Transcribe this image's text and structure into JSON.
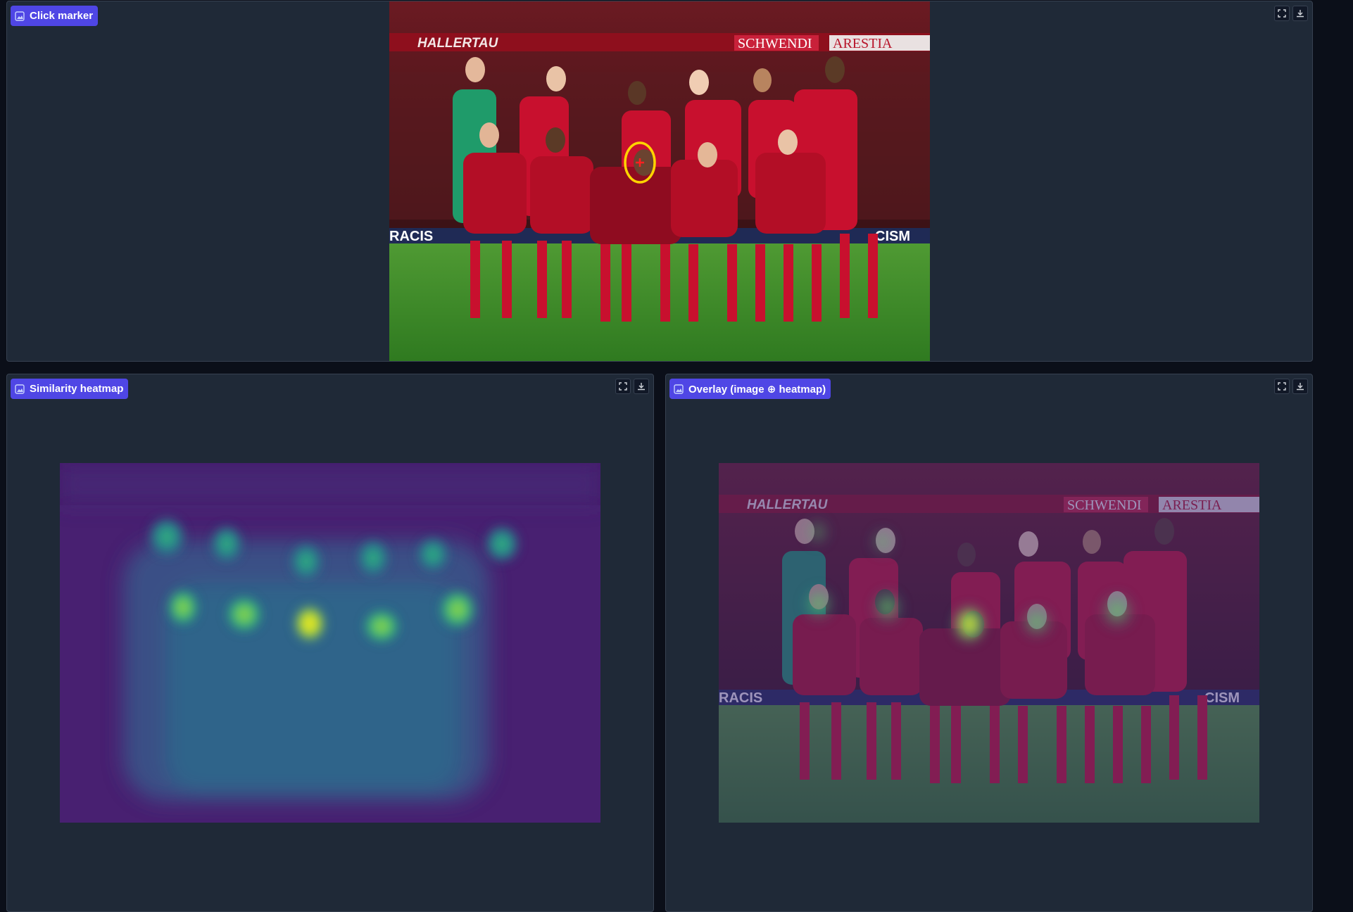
{
  "panels": {
    "click_marker": {
      "label": "Click marker",
      "icon": "image-icon"
    },
    "similarity_heatmap": {
      "label": "Similarity heatmap",
      "icon": "image-icon"
    },
    "overlay": {
      "label": "Overlay (image ⊕ heatmap)",
      "icon": "image-icon"
    }
  },
  "toolbar_icons": [
    "fullscreen-icon",
    "download-icon"
  ],
  "colors": {
    "background": "#0b0f19",
    "panel": "#1f2937",
    "label_chip": "#4f46e5",
    "marker_ring": "#ffd400",
    "marker_cross": "#ff2020",
    "jersey_red": "#c8102e",
    "pitch_green": "#3f8f2a",
    "heatmap_low": "#440154",
    "heatmap_mid": "#21918c",
    "heatmap_high": "#fde725"
  },
  "click_marker": {
    "state": "face selected"
  },
  "banner_text": {
    "left": "HALLERTAU",
    "middle": "SCHWENDI",
    "right": "ARESTIA",
    "lower_left": "RACIS",
    "lower_right": "CISM"
  }
}
